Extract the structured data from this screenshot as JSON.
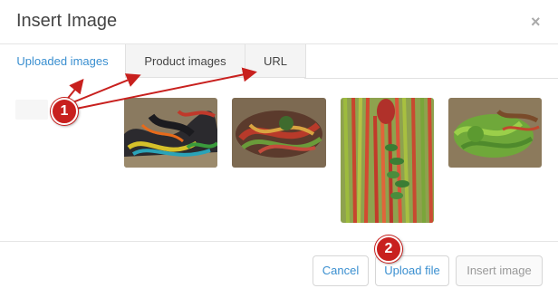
{
  "dialog": {
    "title": "Insert Image",
    "close_symbol": "×"
  },
  "tabs": [
    {
      "label": "Uploaded images",
      "active": true
    },
    {
      "label": "Product images",
      "active": false
    },
    {
      "label": "URL",
      "active": false
    }
  ],
  "images": [
    {
      "description": "bundle of dark yarn with colored threads"
    },
    {
      "description": "colorful coiled yarn on dirt"
    },
    {
      "description": "red and green hanging yarn with leaves"
    },
    {
      "description": "green and brown yarn bundles"
    }
  ],
  "buttons": {
    "cancel": "Cancel",
    "upload": "Upload file",
    "insert": "Insert image"
  },
  "annotations": {
    "marker_1": "1",
    "marker_2": "2",
    "color": "#c8201e"
  },
  "colors": {
    "accent": "#3a8fd0",
    "inactive_tab_bg": "#f4f4f4"
  }
}
